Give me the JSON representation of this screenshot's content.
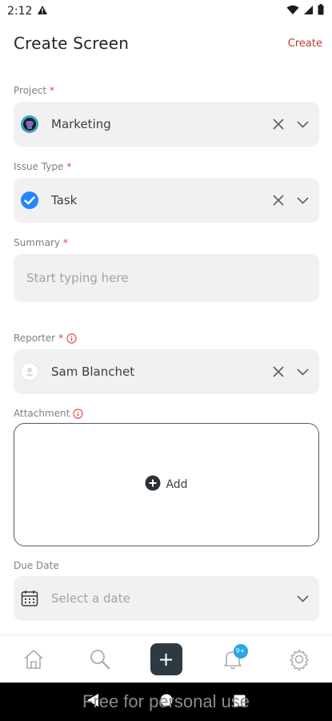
{
  "status_bar": {
    "time": "2:12"
  },
  "header": {
    "title": "Create Screen",
    "create_label": "Create"
  },
  "form": {
    "project": {
      "label": "Project",
      "required_mark": "*",
      "value": "Marketing",
      "icon": "project-avatar-icon"
    },
    "issue_type": {
      "label": "Issue Type",
      "required_mark": "*",
      "value": "Task",
      "icon": "task-check-icon"
    },
    "summary": {
      "label": "Summary",
      "required_mark": "*",
      "placeholder": "Start typing here"
    },
    "reporter": {
      "label": "Reporter",
      "required_mark": "*",
      "value": "Sam Blanchet",
      "icon": "user-avatar-icon"
    },
    "attachment": {
      "label": "Attachment",
      "add_label": "Add"
    },
    "due_date": {
      "label": "Due Date",
      "placeholder": "Select a date"
    }
  },
  "bottom_nav": {
    "items": [
      "home-icon",
      "search-icon",
      "plus-icon",
      "bell-icon",
      "gear-icon"
    ],
    "notification_badge": "9+"
  },
  "watermark": "Free for personal use",
  "colors": {
    "accent_red": "#c0392b",
    "required": "#e0413b",
    "field_bg": "#f1f1f2",
    "task_blue": "#2684ff",
    "plus_button": "#2e3a42",
    "badge_blue": "#27a6e5"
  }
}
